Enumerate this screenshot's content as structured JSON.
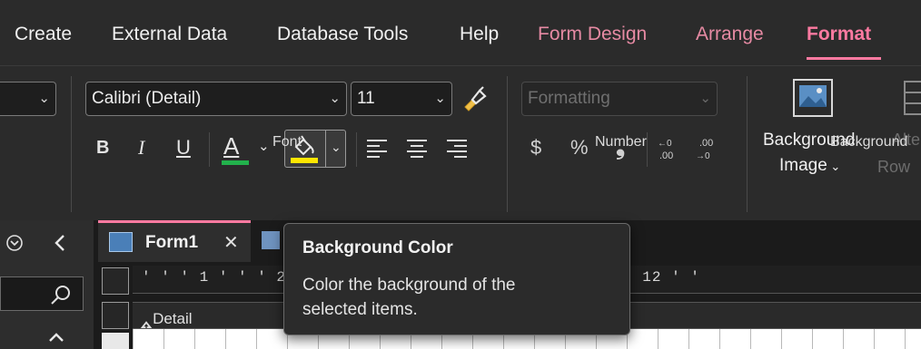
{
  "menu": {
    "tabs": [
      {
        "label": "Create"
      },
      {
        "label": "External Data"
      },
      {
        "label": "Database Tools"
      },
      {
        "label": "Help"
      },
      {
        "label": "Form Design"
      },
      {
        "label": "Arrange"
      },
      {
        "label": "Format"
      }
    ],
    "active_tab": "Format"
  },
  "ribbon": {
    "font_group": {
      "label": "Font",
      "font_name": "Calibri (Detail)",
      "font_size": "11",
      "bold": "B",
      "italic": "I",
      "underline": "U",
      "font_color_glyph": "A"
    },
    "number_group": {
      "label": "Number",
      "format_placeholder": "Formatting",
      "currency": "$",
      "percent": "%",
      "comma": "❟"
    },
    "background_group": {
      "label": "Background",
      "image_label_line1": "Background",
      "image_label_line2": "Image",
      "alt_label_line1": "Alte",
      "alt_label_line2": "Row"
    }
  },
  "document": {
    "tab_label": "Form1",
    "section_label": "Detail",
    "ruler_text": "' ' ' 1 ' ' ' 2 '                                   8 ' ' ' 9 ' ' ' 10 ' ' ' 11 ' ' ' 12 ' '"
  },
  "tooltip": {
    "title": "Background Color",
    "description": "Color the background of the selected items."
  },
  "colors": {
    "accent": "#ff7aa1",
    "font_color_underline": "#22b14c",
    "fill_color_underline": "#ffe600"
  }
}
